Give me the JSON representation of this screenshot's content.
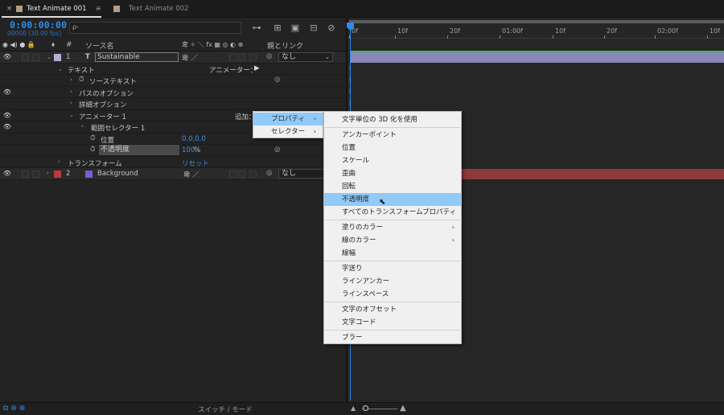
{
  "tabs": [
    {
      "close": "×",
      "label": "Text Animate 001",
      "menu": "≡"
    },
    {
      "label": "Text Animate 002"
    }
  ],
  "timecode": "0:00:00:00",
  "fps": "00000 (30.00 fps)",
  "search": {
    "placeholder": "",
    "icon": "ρ-"
  },
  "columns": {
    "num": "#",
    "source": "ソース名",
    "parent": "親とリンク",
    "switch_icons": "卑 ✧ ＼ fx ▦ ◎ ◐ ⊕"
  },
  "layers": [
    {
      "num": "1",
      "type": "T",
      "name": "Sustainable",
      "parent": "なし",
      "color": "#b5b0d8"
    },
    {
      "num": "2",
      "name": "Background",
      "parent": "なし",
      "color": "#b83a3a",
      "swatch": "#7b5bd0"
    }
  ],
  "tree": {
    "text": "テキスト",
    "animator_label": "アニメーター：",
    "source_text": "ソーステキスト",
    "path_options": "パスのオプション",
    "more_options": "詳細オプション",
    "animator1": "アニメーター 1",
    "add": "追加：",
    "range_selector": "範囲セレクター 1",
    "position": "位置",
    "position_val": "0.0,0.0",
    "opacity": "不透明度",
    "opacity_val": "100",
    "opacity_unit": "%",
    "transform": "トランスフォーム",
    "reset": "リセット"
  },
  "ruler": [
    "0f",
    "10f",
    "20f",
    "01:00f",
    "10f",
    "20f",
    "02:00f",
    "10f"
  ],
  "submenu": {
    "items": [
      {
        "label": "プロパティ",
        "highlighted": true
      },
      {
        "label": "セレクター"
      }
    ]
  },
  "menu": {
    "groups": [
      [
        "文字単位の 3D 化を使用"
      ],
      [
        "アンカーポイント",
        "位置",
        "スケール",
        "歪曲",
        "回転",
        "不透明度",
        "すべてのトランスフォームプロパティ"
      ],
      [
        "塗りのカラー",
        "線のカラー",
        "線幅"
      ],
      [
        "字送り",
        "ラインアンカー",
        "ラインスペース"
      ],
      [
        "文字のオフセット",
        "文字コード"
      ],
      [
        "ブラー"
      ]
    ],
    "highlighted": "不透明度",
    "has_submenu": [
      "塗りのカラー",
      "線のカラー"
    ]
  },
  "footer": {
    "toggle_label": "スイッチ / モード"
  },
  "colors": {
    "accent": "#2d8ceb",
    "highlight": "#91c9f7",
    "layer1_bar": "#8a87b8",
    "layer2_bar": "#8f3a3a"
  }
}
